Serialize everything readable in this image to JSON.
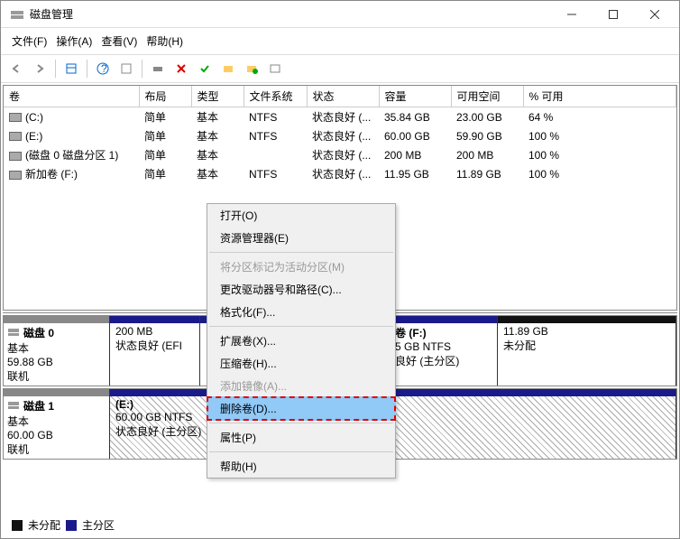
{
  "window": {
    "title": "磁盘管理"
  },
  "menu": {
    "file": "文件(F)",
    "action": "操作(A)",
    "view": "查看(V)",
    "help": "帮助(H)"
  },
  "columns": {
    "vol": "卷",
    "layout": "布局",
    "type": "类型",
    "fs": "文件系统",
    "status": "状态",
    "capacity": "容量",
    "free": "可用空间",
    "pct": "% 可用"
  },
  "volumes": [
    {
      "name": "(C:)",
      "layout": "简单",
      "type": "基本",
      "fs": "NTFS",
      "status": "状态良好 (...",
      "capacity": "35.84 GB",
      "free": "23.00 GB",
      "pct": "64 %"
    },
    {
      "name": "(E:)",
      "layout": "简单",
      "type": "基本",
      "fs": "NTFS",
      "status": "状态良好 (...",
      "capacity": "60.00 GB",
      "free": "59.90 GB",
      "pct": "100 %"
    },
    {
      "name": "(磁盘 0 磁盘分区 1)",
      "layout": "简单",
      "type": "基本",
      "fs": "",
      "status": "状态良好 (...",
      "capacity": "200 MB",
      "free": "200 MB",
      "pct": "100 %"
    },
    {
      "name": "新加卷 (F:)",
      "layout": "简单",
      "type": "基本",
      "fs": "NTFS",
      "status": "状态良好 (...",
      "capacity": "11.95 GB",
      "free": "11.89 GB",
      "pct": "100 %"
    }
  ],
  "disk0": {
    "name": "磁盘 0",
    "type": "基本",
    "size": "59.88 GB",
    "state": "联机",
    "p0": {
      "size": "200 MB",
      "status": "状态良好 (EFI"
    },
    "p2": {
      "label": "卷 (F:)",
      "size": "5 GB NTFS",
      "status": "良好 (主分区)"
    },
    "p3": {
      "size": "11.89 GB",
      "status": "未分配"
    }
  },
  "disk1": {
    "name": "磁盘 1",
    "type": "基本",
    "size": "60.00 GB",
    "state": "联机",
    "p0": {
      "label": "(E:)",
      "size": "60.00 GB NTFS",
      "status": "状态良好 (主分区)"
    }
  },
  "legend": {
    "unalloc": "未分配",
    "primary": "主分区"
  },
  "ctx": {
    "open": "打开(O)",
    "explorer": "资源管理器(E)",
    "active": "将分区标记为活动分区(M)",
    "drive": "更改驱动器号和路径(C)...",
    "format": "格式化(F)...",
    "extend": "扩展卷(X)...",
    "shrink": "压缩卷(H)...",
    "mirror": "添加镜像(A)...",
    "delete": "删除卷(D)...",
    "props": "属性(P)",
    "help": "帮助(H)"
  }
}
